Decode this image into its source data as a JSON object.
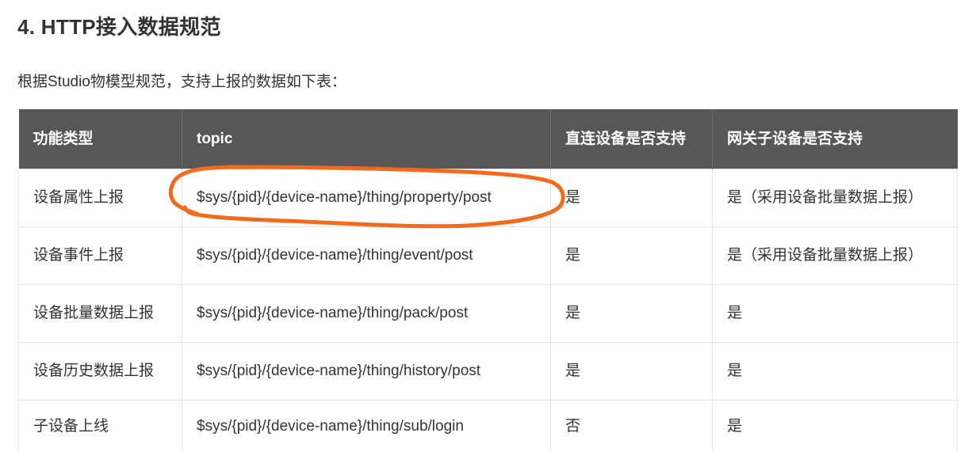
{
  "heading": "4. HTTP接入数据规范",
  "intro": "根据Studio物模型规范，支持上报的数据如下表：",
  "table": {
    "headers": [
      "功能类型",
      "topic",
      "直连设备是否支持",
      "网关子设备是否支持"
    ],
    "rows": [
      [
        "设备属性上报",
        "$sys/{pid}/{device-name}/thing/property/post",
        "是",
        "是（采用设备批量数据上报）"
      ],
      [
        "设备事件上报",
        "$sys/{pid}/{device-name}/thing/event/post",
        "是",
        "是（采用设备批量数据上报）"
      ],
      [
        "设备批量数据上报",
        "$sys/{pid}/{device-name}/thing/pack/post",
        "是",
        "是"
      ],
      [
        "设备历史数据上报",
        "$sys/{pid}/{device-name}/thing/history/post",
        "是",
        "是"
      ],
      [
        "子设备上线",
        "$sys/{pid}/{device-name}/thing/sub/login",
        "否",
        "是"
      ]
    ]
  },
  "annotation": {
    "color": "#f26a1b",
    "target": "topic-cell-property-post"
  }
}
